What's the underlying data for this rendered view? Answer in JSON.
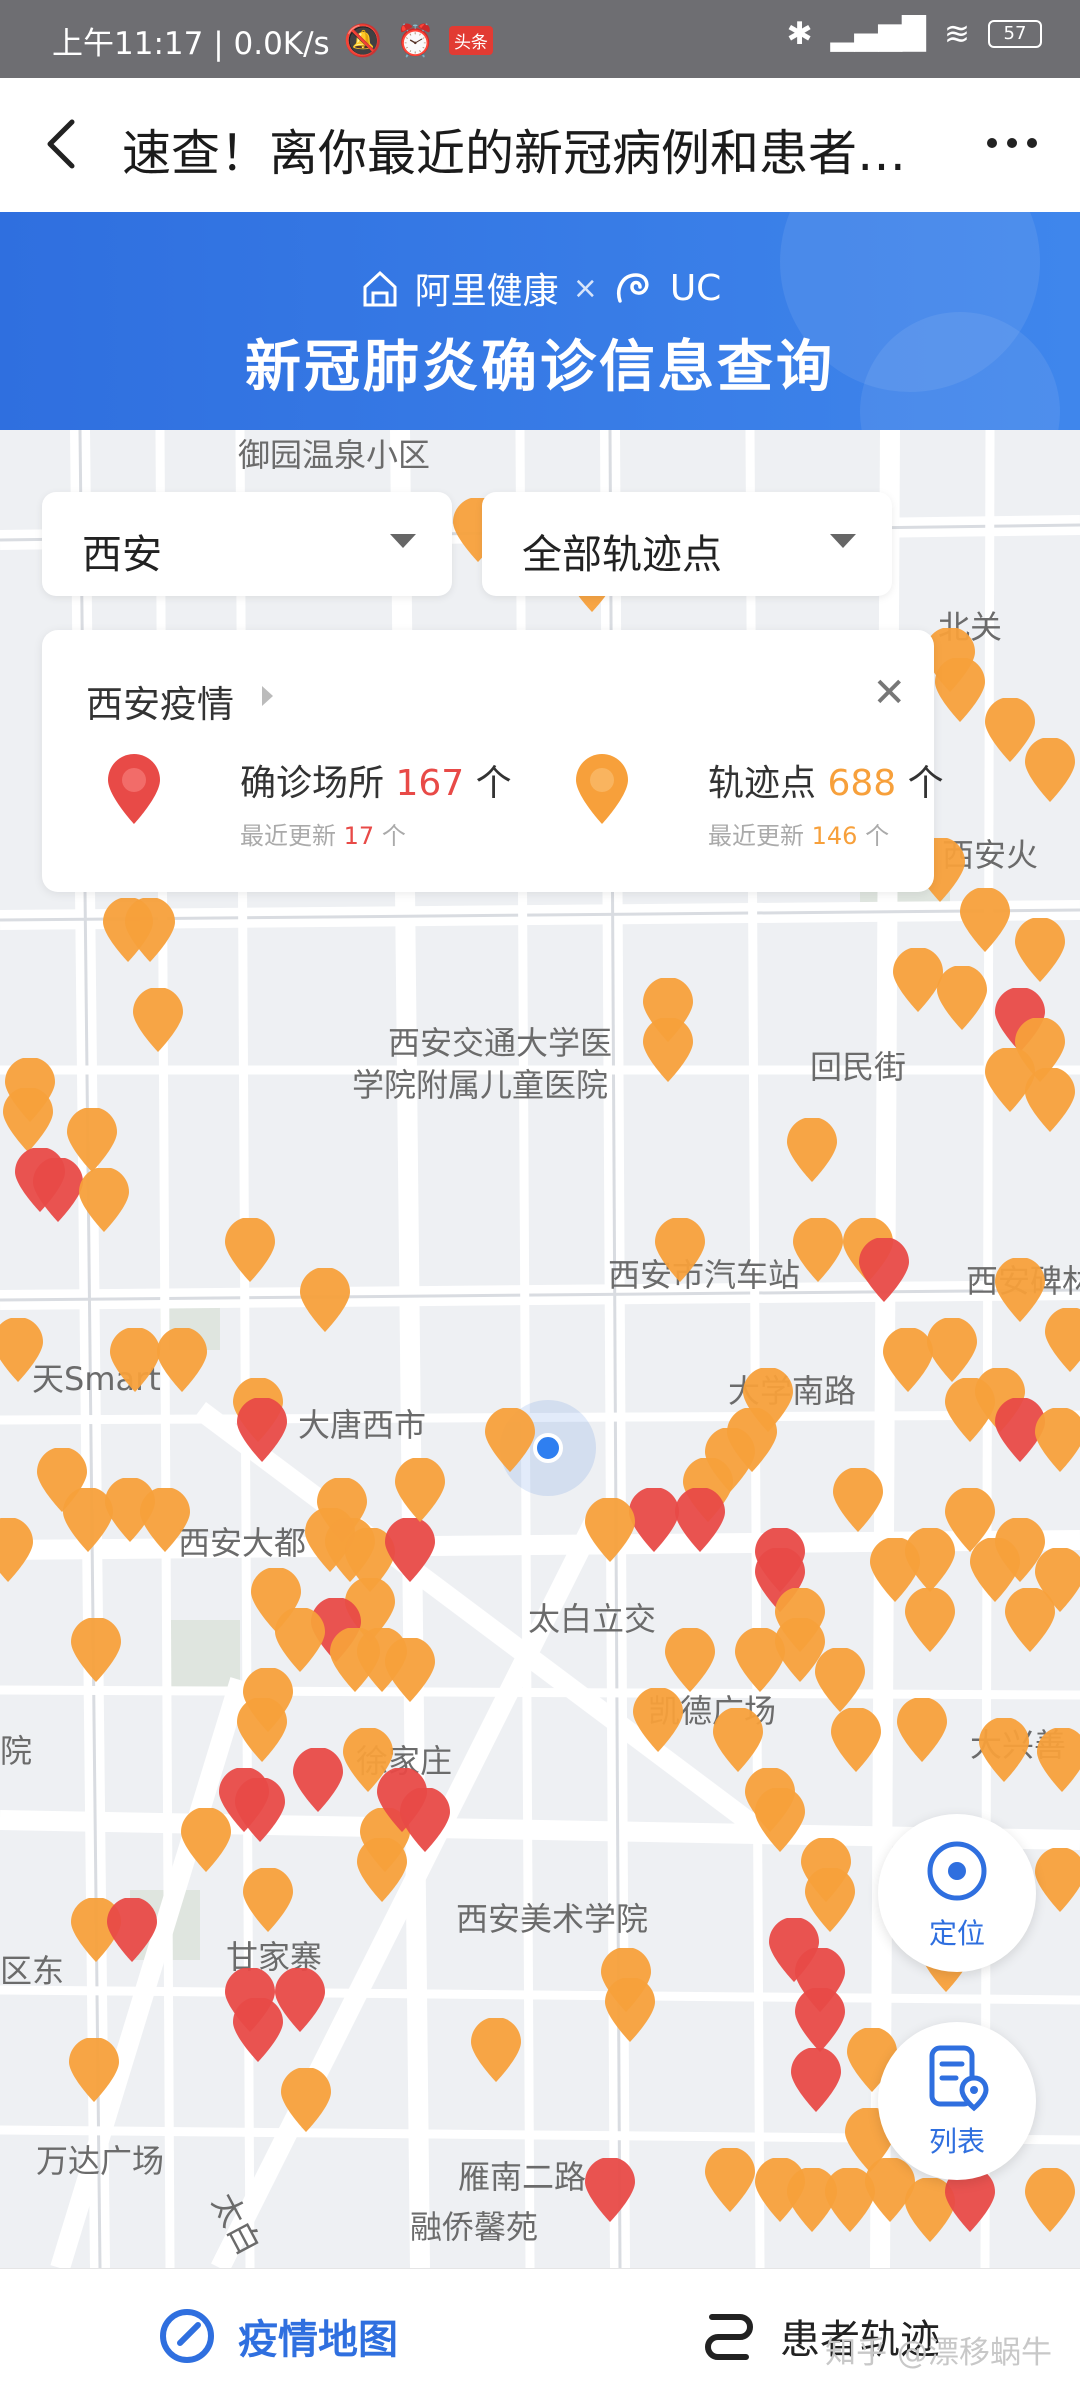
{
  "statusbar": {
    "time_speed": "上午11:17 | 0.0K/s",
    "badge": "头条",
    "battery": "57"
  },
  "header": {
    "title": "速查！离你最近的新冠病例和患者…"
  },
  "banner": {
    "brand1": "阿里健康",
    "cross": "×",
    "brand2": "UC",
    "title": "新冠肺炎确诊信息查询"
  },
  "filters": {
    "city": "西安",
    "point_type": "全部轨迹点"
  },
  "summary": {
    "title": "西安疫情",
    "confirmed_label": "确诊场所",
    "confirmed_count": "167",
    "confirmed_unit": "个",
    "confirmed_update_label": "最近更新",
    "confirmed_update_count": "17",
    "confirmed_update_unit": "个",
    "track_label": "轨迹点",
    "track_count": "688",
    "track_unit": "个",
    "track_update_label": "最近更新",
    "track_update_count": "146",
    "track_update_unit": "个"
  },
  "map": {
    "labels": [
      "御园温泉小区",
      "北关",
      "西安火",
      "西安交通大学医",
      "学院附属儿童医院",
      "回民街",
      "西安市汽车站",
      "西安碑林",
      "天Smart",
      "大学南路",
      "大唐西市",
      "西安大都",
      "太白立交",
      "凯德广场",
      "大兴善",
      "徐家庄",
      "西安美术学院",
      "甘家寨",
      "区东",
      "万达广场",
      "雁南二路",
      "融侨馨苑",
      "院",
      "太白"
    ]
  },
  "buttons": {
    "locate": "定位",
    "list": "列表"
  },
  "tabs": {
    "map": "疫情地图",
    "trace": "患者轨迹"
  },
  "watermark": "知乎 @漂移蜗牛",
  "colors": {
    "brand_blue": "#2f6fdf",
    "pin_orange": "#f7a03b",
    "pin_red": "#e84a47"
  }
}
